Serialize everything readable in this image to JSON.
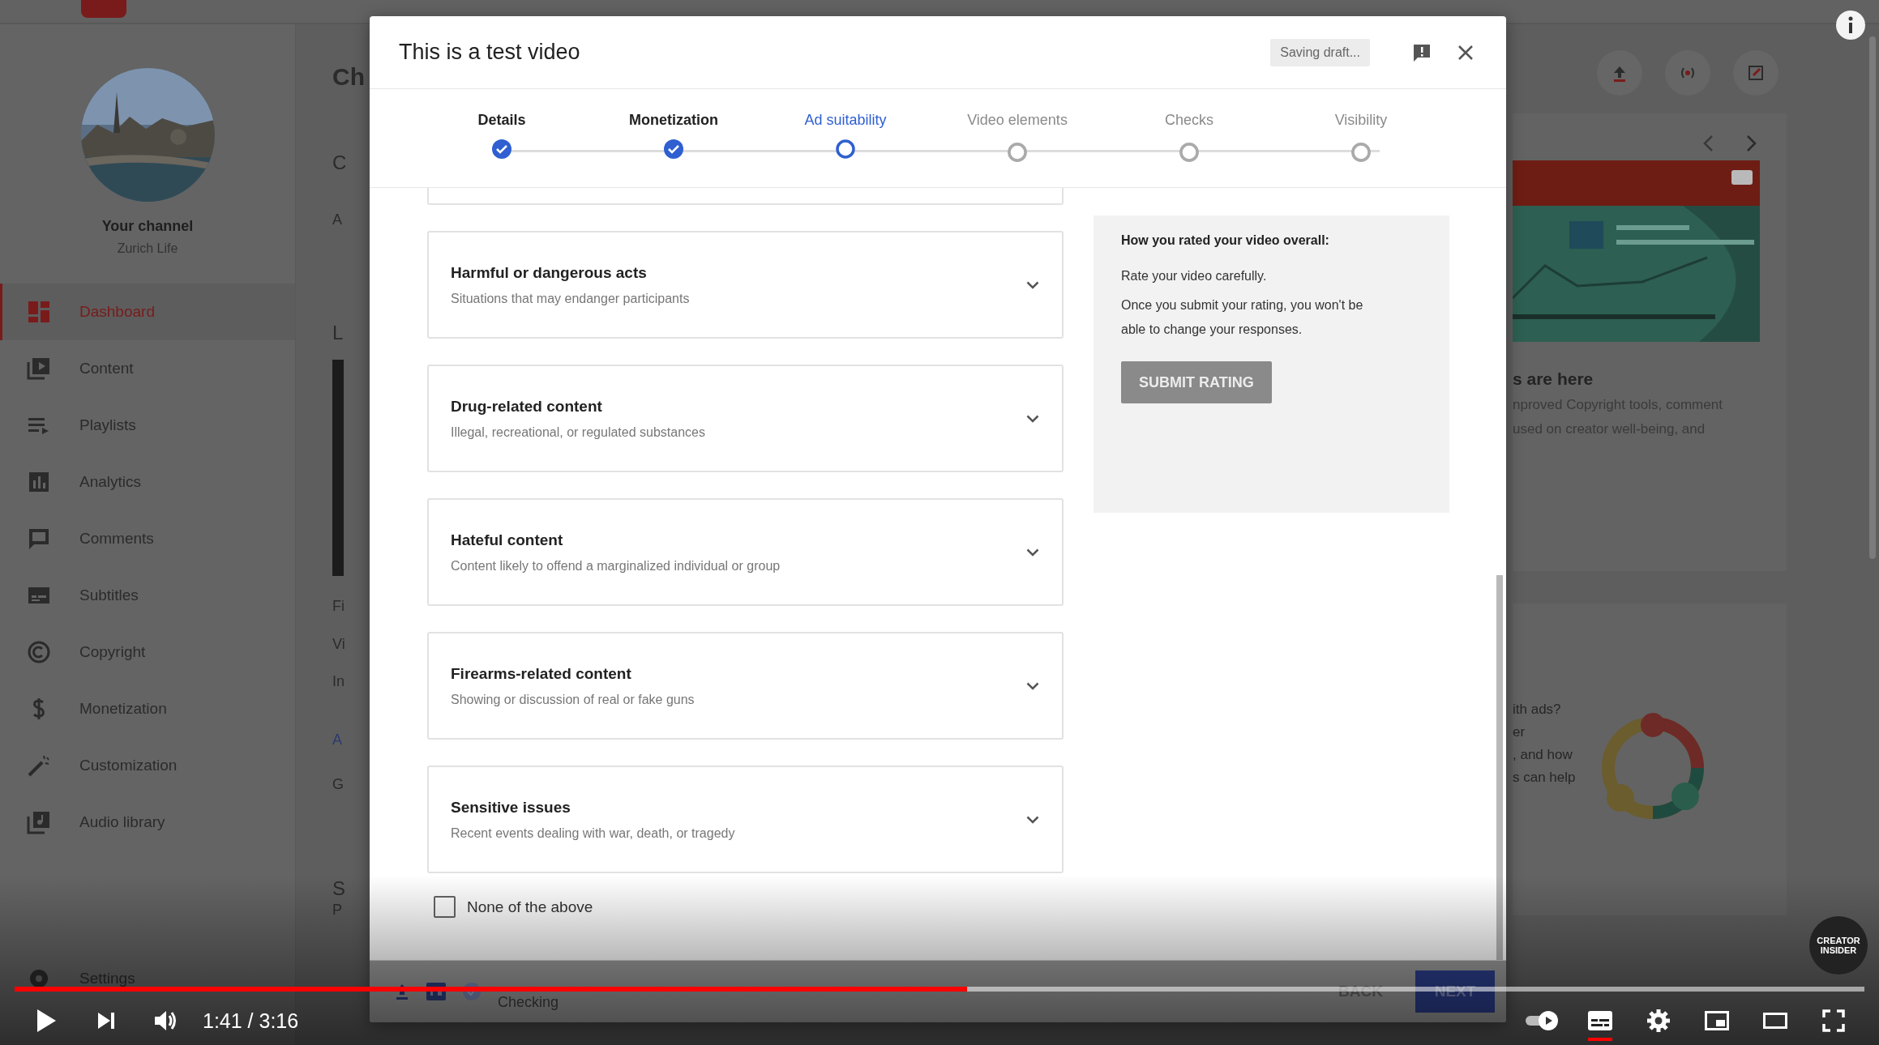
{
  "studio": {
    "channel": {
      "label": "Your channel",
      "name": "Zurich Life"
    },
    "nav": [
      {
        "label": "Dashboard",
        "selected": true
      },
      {
        "label": "Content",
        "selected": false
      },
      {
        "label": "Playlists",
        "selected": false
      },
      {
        "label": "Analytics",
        "selected": false
      },
      {
        "label": "Comments",
        "selected": false
      },
      {
        "label": "Subtitles",
        "selected": false
      },
      {
        "label": "Copyright",
        "selected": false
      },
      {
        "label": "Monetization",
        "selected": false
      },
      {
        "label": "Customization",
        "selected": false
      },
      {
        "label": "Audio library",
        "selected": false
      }
    ],
    "settings_label": "Settings",
    "left_fragments": [
      "Ch",
      "C",
      "A",
      "L",
      "Fi",
      "Vi",
      "In",
      "A",
      "G",
      "S",
      "P"
    ],
    "news_card": {
      "title": "s are here",
      "lines": [
        "nproved Copyright tools, comment",
        "used on creator well-being, and"
      ]
    },
    "ads_card": {
      "lines": [
        "ith ads?",
        "er",
        ", and how",
        "s can help"
      ]
    }
  },
  "dialog": {
    "title": "This is a test video",
    "save_status": "Saving draft...",
    "steps": [
      {
        "label": "Details",
        "done": true,
        "selected": false
      },
      {
        "label": "Monetization",
        "done": true,
        "selected": false
      },
      {
        "label": "Ad suitability",
        "done": false,
        "selected": true
      },
      {
        "label": "Video elements",
        "done": false,
        "selected": false
      },
      {
        "label": "Checks",
        "done": false,
        "selected": false
      },
      {
        "label": "Visibility",
        "done": false,
        "selected": false
      }
    ],
    "categories": [
      {
        "title": "Harmful or dangerous acts",
        "description": "Situations that may endanger participants",
        "expanded": false
      },
      {
        "title": "Drug-related content",
        "description": "Illegal, recreational, or regulated substances",
        "expanded": false
      },
      {
        "title": "Hateful content",
        "description": "Content likely to offend a marginalized individual or group",
        "expanded": false
      },
      {
        "title": "Firearms-related content",
        "description": "Showing or discussion of real or fake guns",
        "expanded": false
      },
      {
        "title": "Sensitive issues",
        "description": "Recent events dealing with war, death, or tragedy",
        "expanded": false
      }
    ],
    "none_option": {
      "label": "None of the above",
      "checked": false
    },
    "rating_panel": {
      "heading": "How you rated your video overall:",
      "note": "Rate your video carefully.",
      "warning": "Once you submit your rating, you won't be able to change your responses.",
      "button": {
        "label": "SUBMIT RATING",
        "disabled": true
      }
    },
    "footer": {
      "status": "Checking",
      "back": "BACK",
      "next": "NEXT"
    }
  },
  "player": {
    "progress": {
      "level": 0.515
    },
    "time": "1:41 / 3:16",
    "autoplay_on": true,
    "subtitles_on": true
  },
  "badge": {
    "lines": [
      "CREATOR",
      "INSIDER"
    ]
  }
}
